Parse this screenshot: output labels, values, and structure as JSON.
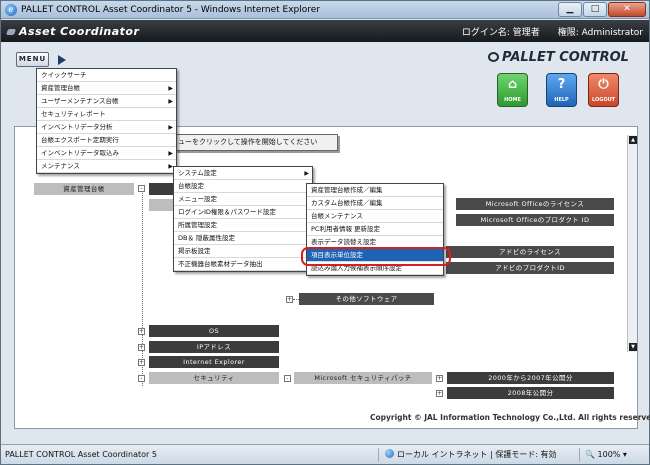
{
  "window": {
    "title": "PALLET CONTROL Asset Coordinator 5 - Windows Internet Explorer",
    "min_glyph": "▁",
    "max_glyph": "□",
    "close_glyph": "✕"
  },
  "header": {
    "logo": "Asset Coordinator",
    "user_info": "ログイン名: 管理者　　権限: Administrator"
  },
  "toolbar": {
    "menu_label": "MENU",
    "brand": "PALLET CONTROL",
    "buttons": [
      {
        "label": "HOME",
        "icon": "house-icon",
        "glyph": "⌂"
      },
      {
        "label": "HELP",
        "icon": "question-icon",
        "glyph": "?"
      },
      {
        "label": "LOGOUT",
        "icon": "logout-icon",
        "glyph": "⏻"
      }
    ]
  },
  "main_menu": {
    "items": [
      {
        "label": "クイックサーチ",
        "submenu": false
      },
      {
        "label": "資産管理台帳",
        "submenu": true
      },
      {
        "label": "ユーザーメンテナンス台帳",
        "submenu": true
      },
      {
        "label": "セキュリティレポート",
        "submenu": false
      },
      {
        "label": "インベントリデータ分析",
        "submenu": true
      },
      {
        "label": "台帳エクスポート定期実行",
        "submenu": false
      },
      {
        "label": "インベントリデータ取込み",
        "submenu": true
      },
      {
        "label": "メンテナンス",
        "submenu": true
      }
    ]
  },
  "maintenance_menu": {
    "items": [
      {
        "label": "システム設定",
        "submenu": true
      },
      {
        "label": "台帳設定",
        "submenu": false
      },
      {
        "label": "メニュー設定",
        "submenu": false
      },
      {
        "label": "ログインID権限＆パスワード設定",
        "submenu": false
      },
      {
        "label": "所属管理設定",
        "submenu": false
      },
      {
        "label": "DB＆ 隠蔽属性設定",
        "submenu": false
      },
      {
        "label": "掲示板設定",
        "submenu": false
      },
      {
        "label": "不正機器台帳素材データ抽出",
        "submenu": false
      }
    ]
  },
  "ledger_menu": {
    "items": [
      {
        "label": "資産管理台帳作成／編集",
        "highlighted": false
      },
      {
        "label": "カスタム台帳作成／編集",
        "highlighted": false
      },
      {
        "label": "台帳メンテナンス",
        "highlighted": false
      },
      {
        "label": "PC利用者情報 更新設定",
        "highlighted": false
      },
      {
        "label": "表示データ読替え設定",
        "highlighted": false
      },
      {
        "label": "項目表示単位設定",
        "highlighted": true
      },
      {
        "label": "読込み論入力候補表示順序設定",
        "highlighted": false
      }
    ]
  },
  "hint": "ニューをクリックして操作を開始してください",
  "tree": {
    "root": "資産管理台帳",
    "nodes": {
      "ms_office_license": "Microsoft Officeのライセンス",
      "ms_office_product_id": "Microsoft Officeのプロダクト ID",
      "adobe_license": "アドビのライセンス",
      "adobe_product_id": "アドビのプロダクトID",
      "other_software": "その他ソフトウェア",
      "os": "OS",
      "ip_address": "IPアドレス",
      "internet_explorer": "Internet Explorer",
      "security": "セキュリティ",
      "ms_security_patch": "Microsoft セキュリティパッチ",
      "published_2000_2007": "2000年から2007年公開分",
      "published_2008": "2008年公開分"
    }
  },
  "copyright": "Copyright  ©  JAL Information Technology Co.,Ltd. All rights reserved.",
  "status": {
    "left": "PALLET CONTROL Asset Coordinator 5",
    "zone": "ローカル イントラネット | 保護モード: 有効",
    "zoom": "100%"
  },
  "colors": {
    "highlight": "#1d63b6",
    "annotation_ring": "#d42020",
    "node_dark": "#4a4a4a",
    "node_light": "#bdbdbd"
  }
}
